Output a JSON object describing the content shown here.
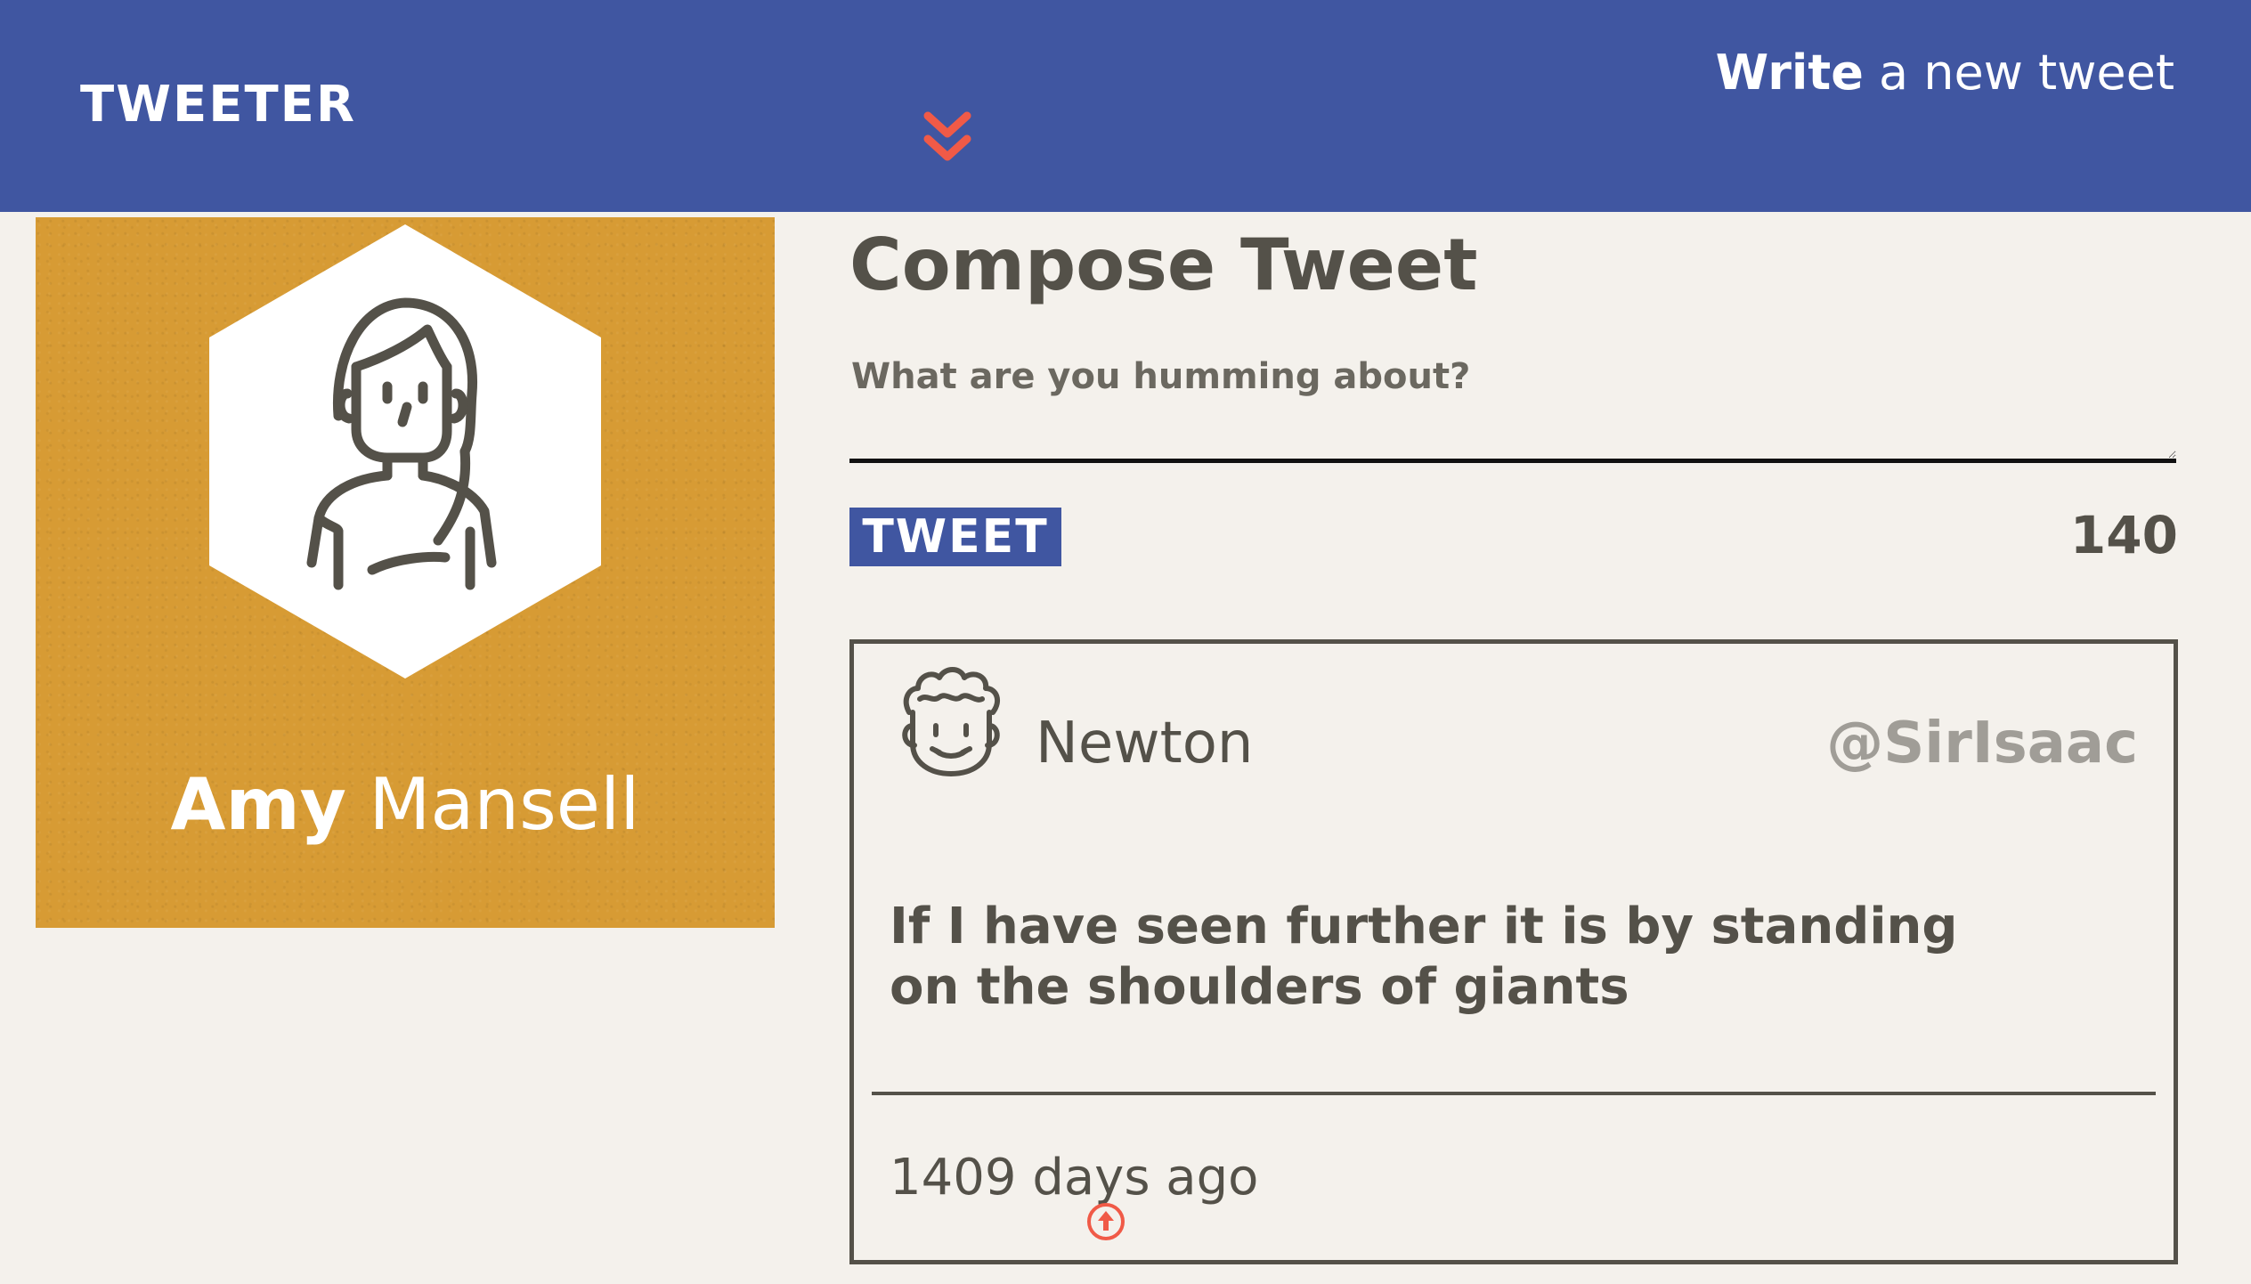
{
  "nav": {
    "brand": "TWEETER",
    "write_strong": "Write",
    "write_rest": "a new tweet",
    "chevron_icon": "double-chevron-down-icon"
  },
  "colors": {
    "nav_bg": "#4056a1",
    "page_bg": "#f4f1ec",
    "profile_bg": "#d79b34",
    "accent": "#f05a47",
    "text": "#545149",
    "handle": "#a09d97"
  },
  "profile": {
    "first_name": "Amy",
    "last_name": "Mansell",
    "avatar_icon": "woman-avatar-icon"
  },
  "compose": {
    "title": "Compose Tweet",
    "placeholder": "What are you humming about?",
    "button_label": "TWEET",
    "counter": "140"
  },
  "tweet": {
    "name": "Newton",
    "handle": "@SirIsaac",
    "content": "If I have seen further it is by standing on the shoulders of giants",
    "time": "1409 days ago",
    "avatar_icon": "curly-hair-man-avatar-icon"
  }
}
